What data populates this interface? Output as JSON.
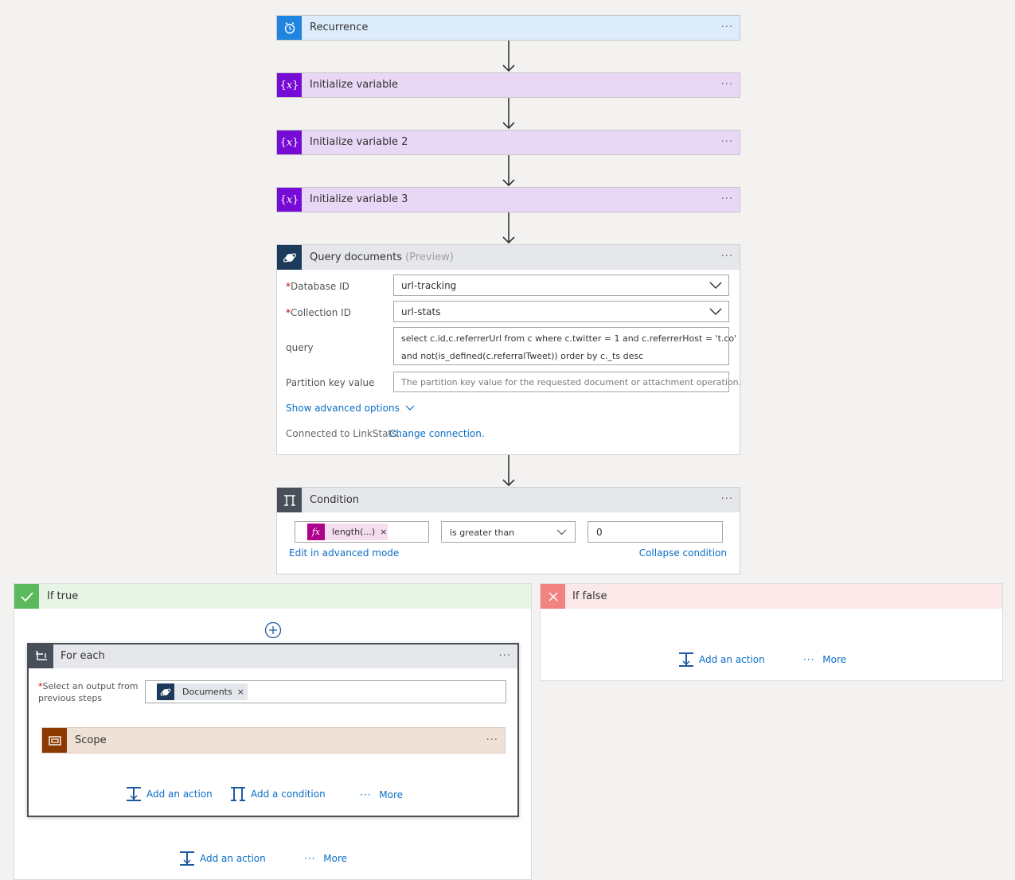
{
  "steps": {
    "recurrence": {
      "title": "Recurrence"
    },
    "init1": {
      "title": "Initialize variable"
    },
    "init2": {
      "title": "Initialize variable 2"
    },
    "init3": {
      "title": "Initialize variable 3"
    }
  },
  "more_dots": "···",
  "query": {
    "title": "Query documents",
    "badge": "(Preview)",
    "database_label": "Database ID",
    "database_value": "url-tracking",
    "collection_label": "Collection ID",
    "collection_value": "url-stats",
    "query_label": "query",
    "query_line1": "select c.id,c.referrerUrl from c where c.twitter = 1 and c.referrerHost = 't.co'",
    "query_line2": "and not(is_defined(c.referralTweet)) order by c._ts desc",
    "partition_label": "Partition key value",
    "partition_placeholder": "The partition key value for the requested document or attachment operation.",
    "advanced": "Show advanced options",
    "connected": "Connected to LinkStats.",
    "change": "Change connection."
  },
  "condition": {
    "title": "Condition",
    "token": "length(...)",
    "operator": "is greater than",
    "value": "0",
    "edit_advanced": "Edit in advanced mode",
    "collapse": "Collapse condition"
  },
  "if_true": {
    "title": "If true",
    "foreach": {
      "title": "For each",
      "select_label_line1": "Select an output from",
      "select_label_line2": "previous steps",
      "token": "Documents",
      "scope_title": "Scope",
      "add_action": "Add an action",
      "add_condition": "Add a condition",
      "more": "More"
    },
    "add_action": "Add an action",
    "more": "More"
  },
  "if_false": {
    "title": "If false",
    "add_action": "Add an action",
    "more": "More"
  },
  "colors": {
    "recurrence_icon": "#1f85de",
    "recurrence_bg": "#dcecfb",
    "variable_icon": "#770bd6",
    "variable_bg": "#e8d7f5",
    "query_icon": "#1c3b5c",
    "condition_icon": "#484f58",
    "true_bg": "#e6f4e6",
    "true_icon": "#5cb85c",
    "false_bg": "#fbe8e8",
    "false_icon": "#f0827f",
    "scope_icon": "#8c3900",
    "scope_bg": "#f0e1d6",
    "link": "#0a6dc6"
  },
  "icons": [
    "alarm-clock-icon",
    "variable-icon",
    "cosmos-db-icon",
    "condition-icon",
    "checkmark-icon",
    "close-icon",
    "foreach-icon",
    "scope-icon",
    "add-action-icon",
    "add-condition-icon",
    "plus-circle-icon",
    "chevron-down-icon",
    "function-icon"
  ]
}
